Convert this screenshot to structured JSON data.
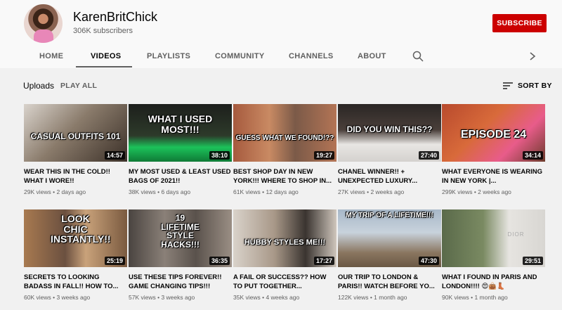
{
  "channel": {
    "name": "KarenBritChick",
    "subscribers": "306K subscribers",
    "subscribe_label": "SUBSCRIBE"
  },
  "tabs": [
    {
      "label": "HOME"
    },
    {
      "label": "VIDEOS"
    },
    {
      "label": "PLAYLISTS"
    },
    {
      "label": "COMMUNITY"
    },
    {
      "label": "CHANNELS"
    },
    {
      "label": "ABOUT"
    }
  ],
  "section": {
    "title": "Uploads",
    "play_all": "PLAY ALL",
    "sort_label": "SORT BY"
  },
  "videos": [
    {
      "thumb_text": "CASUAL OUTFITS 101",
      "duration": "14:57",
      "title": "WEAR THIS IN THE COLD!! WHAT I WORE!!",
      "views": "29K views",
      "age": "2 days ago"
    },
    {
      "thumb_text": "WHAT I USED MOST!!!",
      "duration": "38:10",
      "title": "MY MOST USED & LEAST USED BAGS OF 2021!!",
      "views": "38K views",
      "age": "6 days ago"
    },
    {
      "thumb_text": "GUESS WHAT WE FOUND!??",
      "duration": "19:27",
      "title": "BEST SHOP DAY IN NEW YORK!!! WHERE TO SHOP IN...",
      "views": "61K views",
      "age": "12 days ago"
    },
    {
      "thumb_text": "DID YOU WIN THIS??",
      "duration": "27:40",
      "title": "CHANEL WINNER!! + UNEXPECTED LUXURY...",
      "views": "27K views",
      "age": "2 weeks ago"
    },
    {
      "thumb_text": "EPISODE 24",
      "duration": "34:14",
      "title": "WHAT EVERYONE IS WEARING IN NEW YORK |...",
      "views": "299K views",
      "age": "2 weeks ago"
    },
    {
      "thumb_text": "LOOK CHIC INSTANTLY!!",
      "duration": "25:19",
      "title": "SECRETS TO LOOKING BADASS IN FALL!! HOW TO...",
      "views": "60K views",
      "age": "3 weeks ago"
    },
    {
      "thumb_text": "19 LIFETIME STYLE HACKS!!!",
      "duration": "36:35",
      "title": "USE THESE TIPS FOREVER!! GAME CHANGING TIPS!!!",
      "views": "57K views",
      "age": "3 weeks ago"
    },
    {
      "thumb_text": "HUBBY STYLES ME!!!",
      "duration": "17:27",
      "title": "A FAIL OR SUCCESS?? HOW TO PUT TOGETHER...",
      "views": "35K views",
      "age": "4 weeks ago"
    },
    {
      "thumb_text": "MY TRIP OF A LIFETIME!!!",
      "duration": "47:30",
      "title": "OUR TRIP TO LONDON & PARIS!! WATCH BEFORE YO...",
      "views": "122K views",
      "age": "1 month ago"
    },
    {
      "thumb_text": "DIOR",
      "duration": "29:51",
      "title": "WHAT I FOUND IN PARIS AND LONDON!!!! 😍👜👢",
      "views": "90K views",
      "age": "1 month ago"
    }
  ],
  "colors": {
    "subscribe": "#cc0000",
    "background": "#f9f9f9",
    "content_bg": "#f1f1f1",
    "secondary_text": "#606060"
  }
}
